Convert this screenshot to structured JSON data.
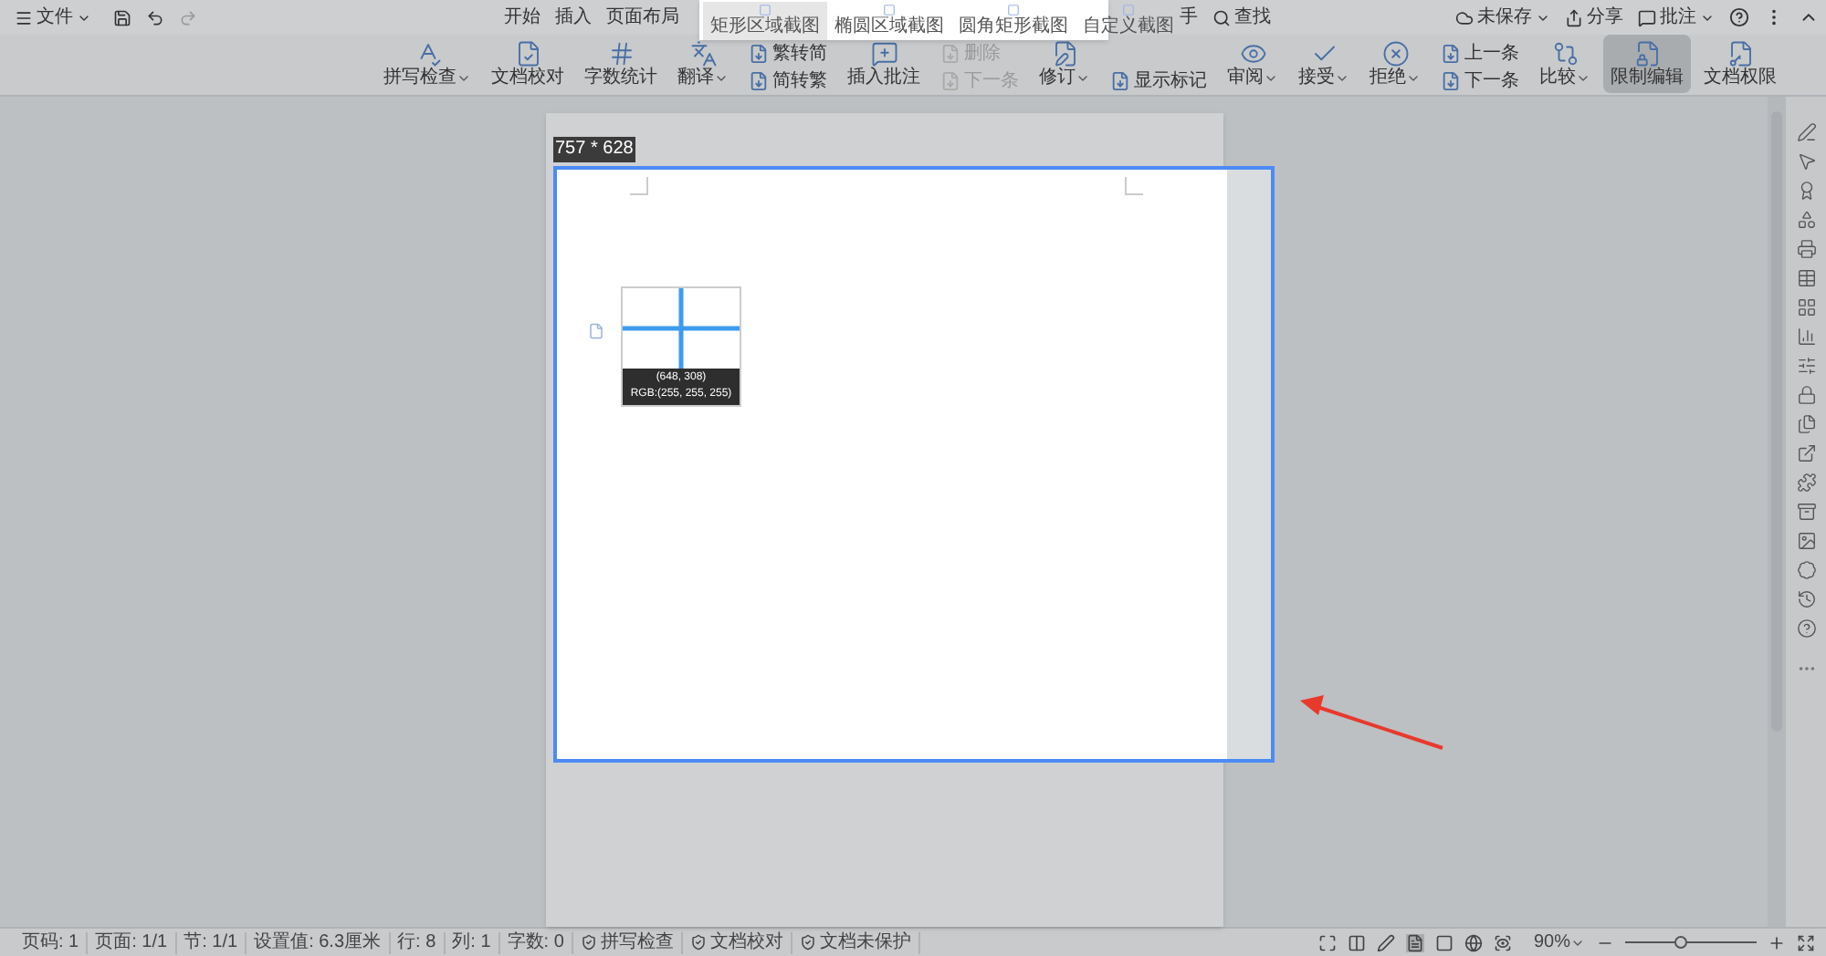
{
  "title_bar": {
    "file_menu": "文件",
    "tabs": [
      {
        "label": "开始"
      },
      {
        "label": "插入"
      },
      {
        "label": "页面布局"
      }
    ],
    "partial_tab": "手",
    "search": "查找",
    "right_actions": [
      {
        "label": "未保存",
        "dropdown": true
      },
      {
        "label": "分享",
        "dropdown": false
      },
      {
        "label": "批注",
        "dropdown": true
      }
    ]
  },
  "ribbon": [
    {
      "kind": "large",
      "label": "拼写检查",
      "dropdown": true,
      "disabled": false,
      "selected": false
    },
    {
      "kind": "large",
      "label": "文档校对",
      "dropdown": false,
      "disabled": false,
      "selected": false
    },
    {
      "kind": "large",
      "label": "字数统计",
      "dropdown": false,
      "disabled": false,
      "selected": false
    },
    {
      "kind": "large",
      "label": "翻译",
      "dropdown": true,
      "disabled": false,
      "selected": false
    },
    {
      "kind": "pair",
      "items": [
        {
          "label": "繁转简",
          "disabled": false
        },
        {
          "label": "简转繁",
          "disabled": false
        }
      ]
    },
    {
      "kind": "large",
      "label": "插入批注",
      "dropdown": false,
      "disabled": false,
      "selected": false
    },
    {
      "kind": "pair",
      "items": [
        {
          "label": "删除",
          "disabled": true
        },
        {
          "label": "下一条",
          "disabled": true
        }
      ]
    },
    {
      "kind": "large",
      "label": "修订",
      "dropdown": true,
      "disabled": false,
      "selected": false
    },
    {
      "kind": "pair",
      "items": [
        {
          "label": "显示标记",
          "disabled": false
        }
      ]
    },
    {
      "kind": "large",
      "label": "审阅",
      "dropdown": true,
      "disabled": false,
      "selected": false
    },
    {
      "kind": "large",
      "label": "接受",
      "dropdown": true,
      "disabled": false,
      "selected": false
    },
    {
      "kind": "large",
      "label": "拒绝",
      "dropdown": true,
      "disabled": false,
      "selected": false
    },
    {
      "kind": "pair",
      "items": [
        {
          "label": "上一条",
          "disabled": false
        },
        {
          "label": "下一条",
          "disabled": false
        }
      ]
    },
    {
      "kind": "large",
      "label": "比较",
      "dropdown": true,
      "disabled": false,
      "selected": false
    },
    {
      "kind": "large",
      "label": "限制编辑",
      "dropdown": false,
      "disabled": false,
      "selected": true
    },
    {
      "kind": "large",
      "label": "文档权限",
      "dropdown": false,
      "disabled": false,
      "selected": false
    }
  ],
  "capture_menu": [
    {
      "label": "矩形区域截图",
      "selected": true
    },
    {
      "label": "椭圆区域截图",
      "selected": false
    },
    {
      "label": "圆角矩形截图",
      "selected": false
    },
    {
      "label": "自定义截图",
      "selected": false
    }
  ],
  "capture": {
    "size": "757 * 628",
    "magnifier_position": "(648, 308)",
    "magnifier_rgb": "RGB:(255, 255, 255)"
  },
  "status_bar": {
    "items": [
      {
        "kind": "text",
        "label": "页码: 1"
      },
      {
        "kind": "text",
        "label": "页面: 1/1"
      },
      {
        "kind": "text",
        "label": "节: 1/1"
      },
      {
        "kind": "text",
        "label": "设置值: 6.3厘米"
      },
      {
        "kind": "text",
        "label": "行: 8"
      },
      {
        "kind": "text",
        "label": "列: 1"
      },
      {
        "kind": "text",
        "label": "字数: 0"
      },
      {
        "kind": "button",
        "label": "拼写检查"
      },
      {
        "kind": "button",
        "label": "文档校对"
      },
      {
        "kind": "button",
        "label": "文档未保护"
      }
    ],
    "zoom": "90%",
    "zoom_slider": {
      "level": 0.42
    }
  }
}
